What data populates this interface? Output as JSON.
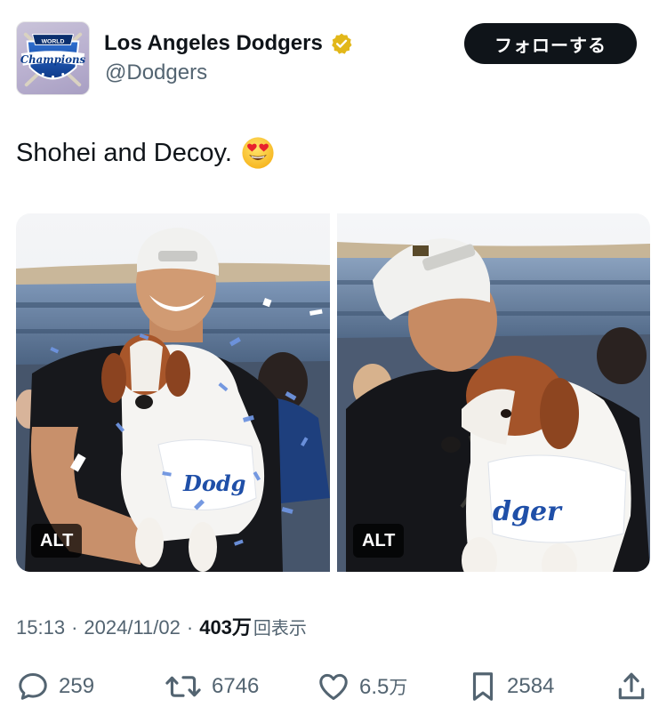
{
  "header": {
    "display_name": "Los Angeles Dodgers",
    "handle": "@Dodgers",
    "follow_label": "フォローする",
    "avatar_text": [
      "WORLD",
      "Champions"
    ]
  },
  "tweet": {
    "text": "Shohei and Decoy.",
    "emoji": "smiling-face-with-heart-eyes"
  },
  "media": [
    {
      "alt_badge": "ALT"
    },
    {
      "alt_badge": "ALT"
    }
  ],
  "meta": {
    "time": "15:13",
    "separator": "·",
    "date": "2024/11/02",
    "views_count": "403万",
    "views_label": "回表示"
  },
  "actions": {
    "replies": "259",
    "reposts": "6746",
    "likes": "6.5",
    "likes_unit": "万",
    "bookmarks": "2584"
  },
  "colors": {
    "text_primary": "#0f1419",
    "text_secondary": "#536471",
    "verified_gold": "#e2b719",
    "dodger_blue": "#005a9c",
    "follow_bg": "#0f1419"
  }
}
